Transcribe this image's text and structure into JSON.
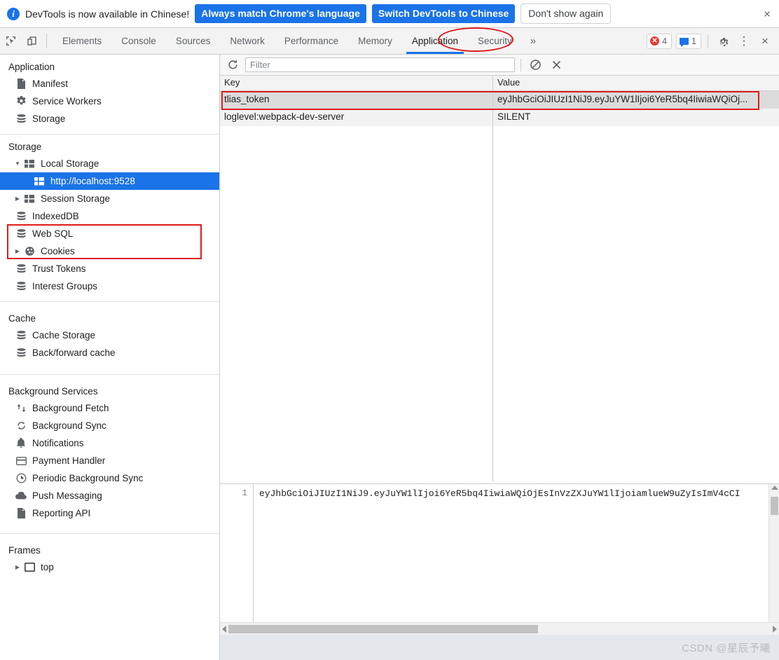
{
  "banner": {
    "icon": "info-icon",
    "message": "DevTools is now available in Chinese!",
    "primary_button": "Always match Chrome's language",
    "secondary_button": "Switch DevTools to Chinese",
    "dismiss_button": "Don't show again",
    "close_icon": "×"
  },
  "toolbar": {
    "inspect_icon": "inspect-element-icon",
    "device_icon": "device-toolbar-icon",
    "tabs": [
      {
        "label": "Elements",
        "selected": false
      },
      {
        "label": "Console",
        "selected": false
      },
      {
        "label": "Sources",
        "selected": false
      },
      {
        "label": "Network",
        "selected": false
      },
      {
        "label": "Performance",
        "selected": false
      },
      {
        "label": "Memory",
        "selected": false
      },
      {
        "label": "Application",
        "selected": true
      },
      {
        "label": "Security",
        "selected": false
      }
    ],
    "more_tabs_icon": "»",
    "error_count": "4",
    "message_count": "1",
    "settings_icon": "gear-icon",
    "more_options_icon": "⋮",
    "close_icon": "×",
    "accent_color": "#1a73e8",
    "error_color": "#e53935",
    "annotation_color": "#de1818"
  },
  "sidebar": {
    "sections": [
      {
        "title": "Application",
        "items": [
          {
            "label": "Manifest",
            "icon": "manifest-file-icon",
            "indent": 0,
            "arrow": "",
            "selected": false
          },
          {
            "label": "Service Workers",
            "icon": "gear-icon",
            "indent": 0,
            "arrow": "",
            "selected": false
          },
          {
            "label": "Storage",
            "icon": "database-icon",
            "indent": 0,
            "arrow": "",
            "selected": false
          }
        ]
      },
      {
        "title": "Storage",
        "items": [
          {
            "label": "Local Storage",
            "icon": "table-grid-icon",
            "indent": 0,
            "arrow": "▼",
            "selected": false
          },
          {
            "label": "http://localhost:9528",
            "icon": "table-grid-icon",
            "indent": 1,
            "arrow": "",
            "selected": true
          },
          {
            "label": "Session Storage",
            "icon": "table-grid-icon",
            "indent": 0,
            "arrow": "▶",
            "selected": false
          },
          {
            "label": "IndexedDB",
            "icon": "database-icon",
            "indent": 0,
            "arrow": "",
            "selected": false
          },
          {
            "label": "Web SQL",
            "icon": "database-icon",
            "indent": 0,
            "arrow": "",
            "selected": false
          },
          {
            "label": "Cookies",
            "icon": "cookie-icon",
            "indent": 0,
            "arrow": "▶",
            "selected": false
          },
          {
            "label": "Trust Tokens",
            "icon": "database-icon",
            "indent": 0,
            "arrow": "",
            "selected": false
          },
          {
            "label": "Interest Groups",
            "icon": "database-icon",
            "indent": 0,
            "arrow": "",
            "selected": false
          }
        ]
      },
      {
        "title": "Cache",
        "items": [
          {
            "label": "Cache Storage",
            "icon": "database-icon",
            "indent": 0,
            "arrow": "",
            "selected": false
          },
          {
            "label": "Back/forward cache",
            "icon": "database-icon",
            "indent": 0,
            "arrow": "",
            "selected": false
          }
        ]
      },
      {
        "title": "Background Services",
        "items": [
          {
            "label": "Background Fetch",
            "icon": "arrows-updown-icon",
            "indent": 0,
            "arrow": "",
            "selected": false
          },
          {
            "label": "Background Sync",
            "icon": "sync-icon",
            "indent": 0,
            "arrow": "",
            "selected": false
          },
          {
            "label": "Notifications",
            "icon": "bell-icon",
            "indent": 0,
            "arrow": "",
            "selected": false
          },
          {
            "label": "Payment Handler",
            "icon": "credit-card-icon",
            "indent": 0,
            "arrow": "",
            "selected": false
          },
          {
            "label": "Periodic Background Sync",
            "icon": "clock-icon",
            "indent": 0,
            "arrow": "",
            "selected": false
          },
          {
            "label": "Push Messaging",
            "icon": "cloud-icon",
            "indent": 0,
            "arrow": "",
            "selected": false
          },
          {
            "label": "Reporting API",
            "icon": "document-icon",
            "indent": 0,
            "arrow": "",
            "selected": false
          }
        ]
      },
      {
        "title": "Frames",
        "items": [
          {
            "label": "top",
            "icon": "frame-icon",
            "indent": 0,
            "arrow": "▶",
            "selected": false
          }
        ]
      }
    ]
  },
  "panel": {
    "refresh_icon": "refresh-icon",
    "filter_placeholder": "Filter",
    "filter_value": "",
    "clear_icon": "clear-all-icon",
    "delete_icon": "delete-selected-icon",
    "table": {
      "columns": [
        "Key",
        "Value"
      ],
      "rows": [
        {
          "key": "tlias_token",
          "value": "eyJhbGciOiJIUzI1NiJ9.eyJuYW1lIjoi6YeR5bq4IiwiaWQiOj...",
          "selected": true
        },
        {
          "key": "loglevel:webpack-dev-server",
          "value": "SILENT",
          "selected": false
        }
      ]
    },
    "preview": {
      "line_number": "1",
      "content": "eyJhbGciOiJIUzI1NiJ9.eyJuYW1lIjoi6YeR5bq4IiwiaWQiOjEsInVzZXJuYW1lIjoiamlueW9uZyIsImV4cCI"
    }
  },
  "footer": {
    "watermark": "CSDN @星辰予曦"
  }
}
